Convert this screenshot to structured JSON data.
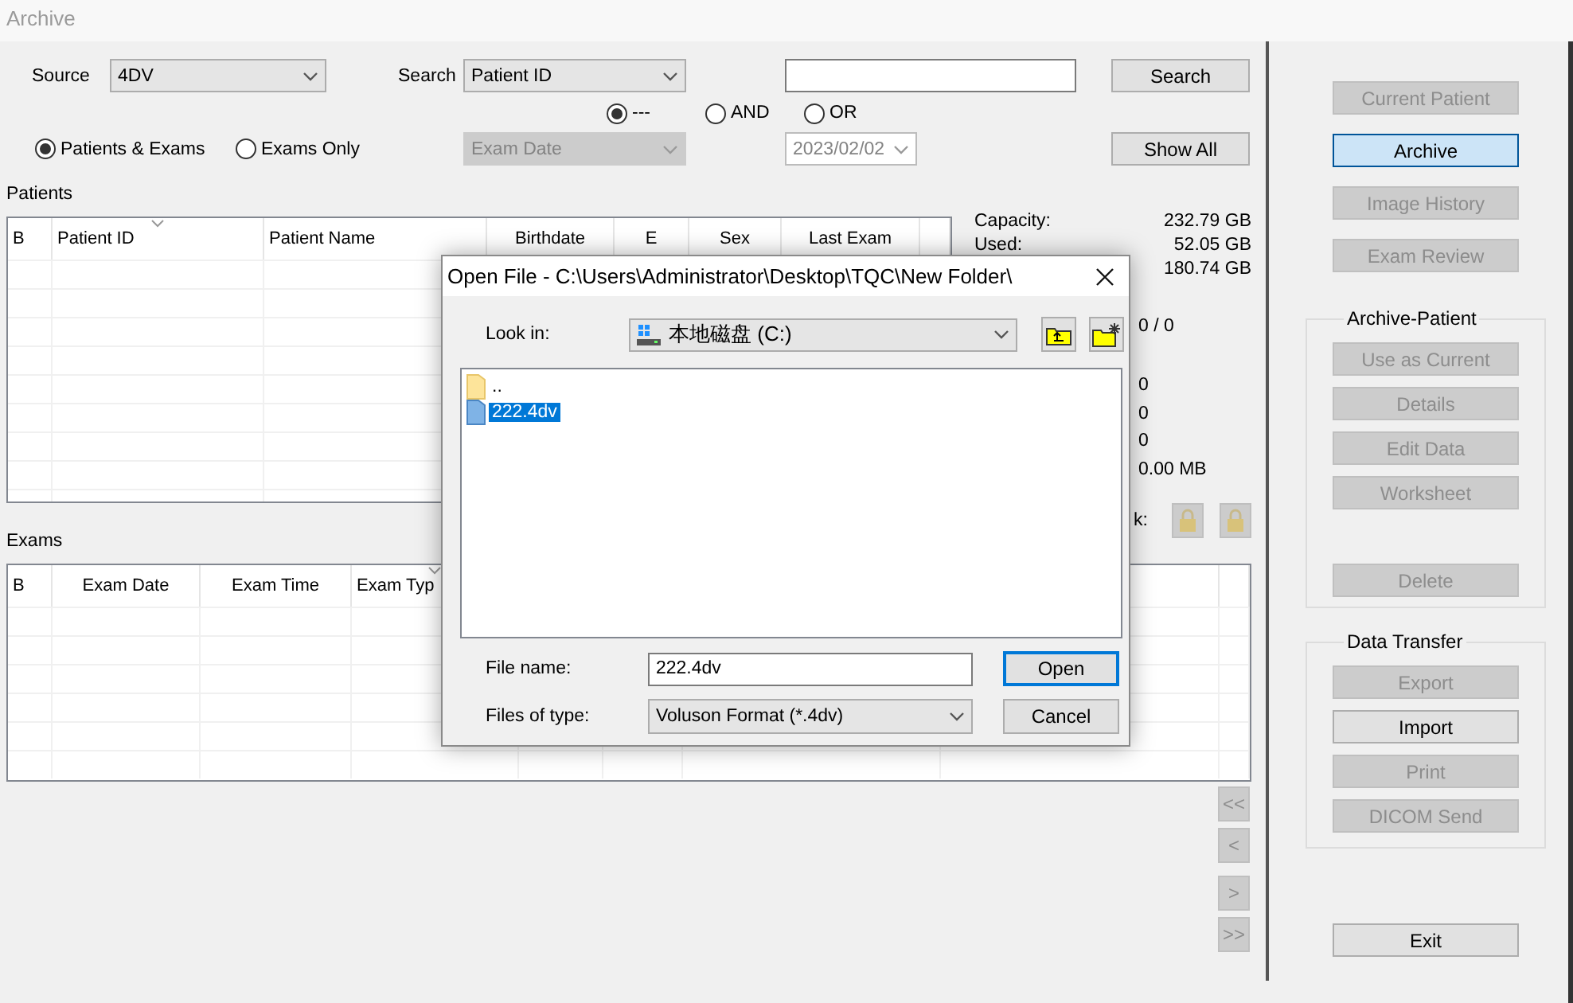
{
  "window": {
    "title": "Archive"
  },
  "source": {
    "label": "Source",
    "value": "4DV"
  },
  "search": {
    "label": "Search",
    "field": "Patient ID",
    "button": "Search"
  },
  "operators": [
    {
      "label": "---",
      "selected": true
    },
    {
      "label": "AND",
      "selected": false
    },
    {
      "label": "OR",
      "selected": false
    }
  ],
  "scope": [
    {
      "label": "Patients & Exams",
      "selected": true
    },
    {
      "label": "Exams Only",
      "selected": false
    }
  ],
  "second_field": {
    "value": "Exam Date",
    "disabled": true
  },
  "date_field": {
    "value": "2023/02/02",
    "disabled": true
  },
  "show_all": "Show All",
  "patients": {
    "title": "Patients",
    "columns": [
      {
        "label": "B",
        "sorted": false
      },
      {
        "label": "Patient ID",
        "sorted": true
      },
      {
        "label": "Patient Name",
        "sorted": false
      },
      {
        "label": "Birthdate",
        "sorted": false
      },
      {
        "label": "E",
        "sorted": false
      },
      {
        "label": "Sex",
        "sorted": false
      },
      {
        "label": "Last Exam",
        "sorted": false
      }
    ]
  },
  "storage": {
    "groups": [
      {
        "kind": "totals",
        "rows": [
          {
            "label": "Capacity:",
            "value": "232.79 GB"
          },
          {
            "label": "Used:",
            "value": "52.05 GB"
          },
          {
            "value": "180.74 GB"
          }
        ]
      },
      {
        "kind": "counts",
        "rows": [
          {
            "value": "0 / 0"
          }
        ]
      },
      {
        "kind": "counts",
        "rows": [
          {
            "value": "0"
          },
          {
            "value": "0"
          },
          {
            "value": "0"
          },
          {
            "value": "0.00 MB"
          }
        ]
      }
    ],
    "lock_label": "k:",
    "lock_buttons": [
      {
        "disabled": true
      },
      {
        "disabled": true
      }
    ]
  },
  "exams": {
    "title": "Exams",
    "columns": [
      {
        "label": "B",
        "sorted": false
      },
      {
        "label": "Exam Date",
        "sorted": false
      },
      {
        "label": "Exam Time",
        "sorted": false
      },
      {
        "label": "Exam Typ",
        "sorted": true
      }
    ]
  },
  "pager": [
    {
      "label": "<<",
      "disabled": true
    },
    {
      "label": "<",
      "disabled": true
    },
    {
      "label": ">",
      "disabled": true
    },
    {
      "label": ">>",
      "disabled": true
    }
  ],
  "nav_buttons": [
    {
      "label": "Current Patient",
      "disabled": true,
      "selected": false
    },
    {
      "label": "Archive",
      "disabled": false,
      "selected": true
    },
    {
      "label": "Image History",
      "disabled": true,
      "selected": false
    },
    {
      "label": "Exam Review",
      "disabled": true,
      "selected": false
    }
  ],
  "groups": [
    {
      "title": "Archive-Patient",
      "buttons": [
        {
          "label": "Use as Current",
          "disabled": true
        },
        {
          "label": "Details",
          "disabled": true
        },
        {
          "label": "Edit Data",
          "disabled": true
        },
        {
          "label": "Worksheet",
          "disabled": true
        },
        {
          "label": "Delete",
          "disabled": true
        }
      ]
    },
    {
      "title": "Data Transfer",
      "buttons": [
        {
          "label": "Export",
          "disabled": true
        },
        {
          "label": "Import",
          "disabled": false
        },
        {
          "label": "Print",
          "disabled": true
        },
        {
          "label": "DICOM Send",
          "disabled": true
        }
      ]
    }
  ],
  "exit": "Exit",
  "dialog": {
    "title": "Open File - C:\\Users\\Administrator\\Desktop\\TQC\\New Folder\\",
    "look_in": {
      "label": "Look in:",
      "value": "本地磁盘 (C:)"
    },
    "files": [
      {
        "name": "..",
        "kind": "folder",
        "selected": false
      },
      {
        "name": "222.4dv",
        "kind": "file",
        "selected": true
      }
    ],
    "file_name": {
      "label": "File name:",
      "value": "222.4dv"
    },
    "file_type": {
      "label": "Files of type:",
      "value": "Voluson Format (*.4dv)"
    },
    "buttons": [
      {
        "label": "Open",
        "default": true
      },
      {
        "label": "Cancel",
        "default": false
      }
    ]
  }
}
